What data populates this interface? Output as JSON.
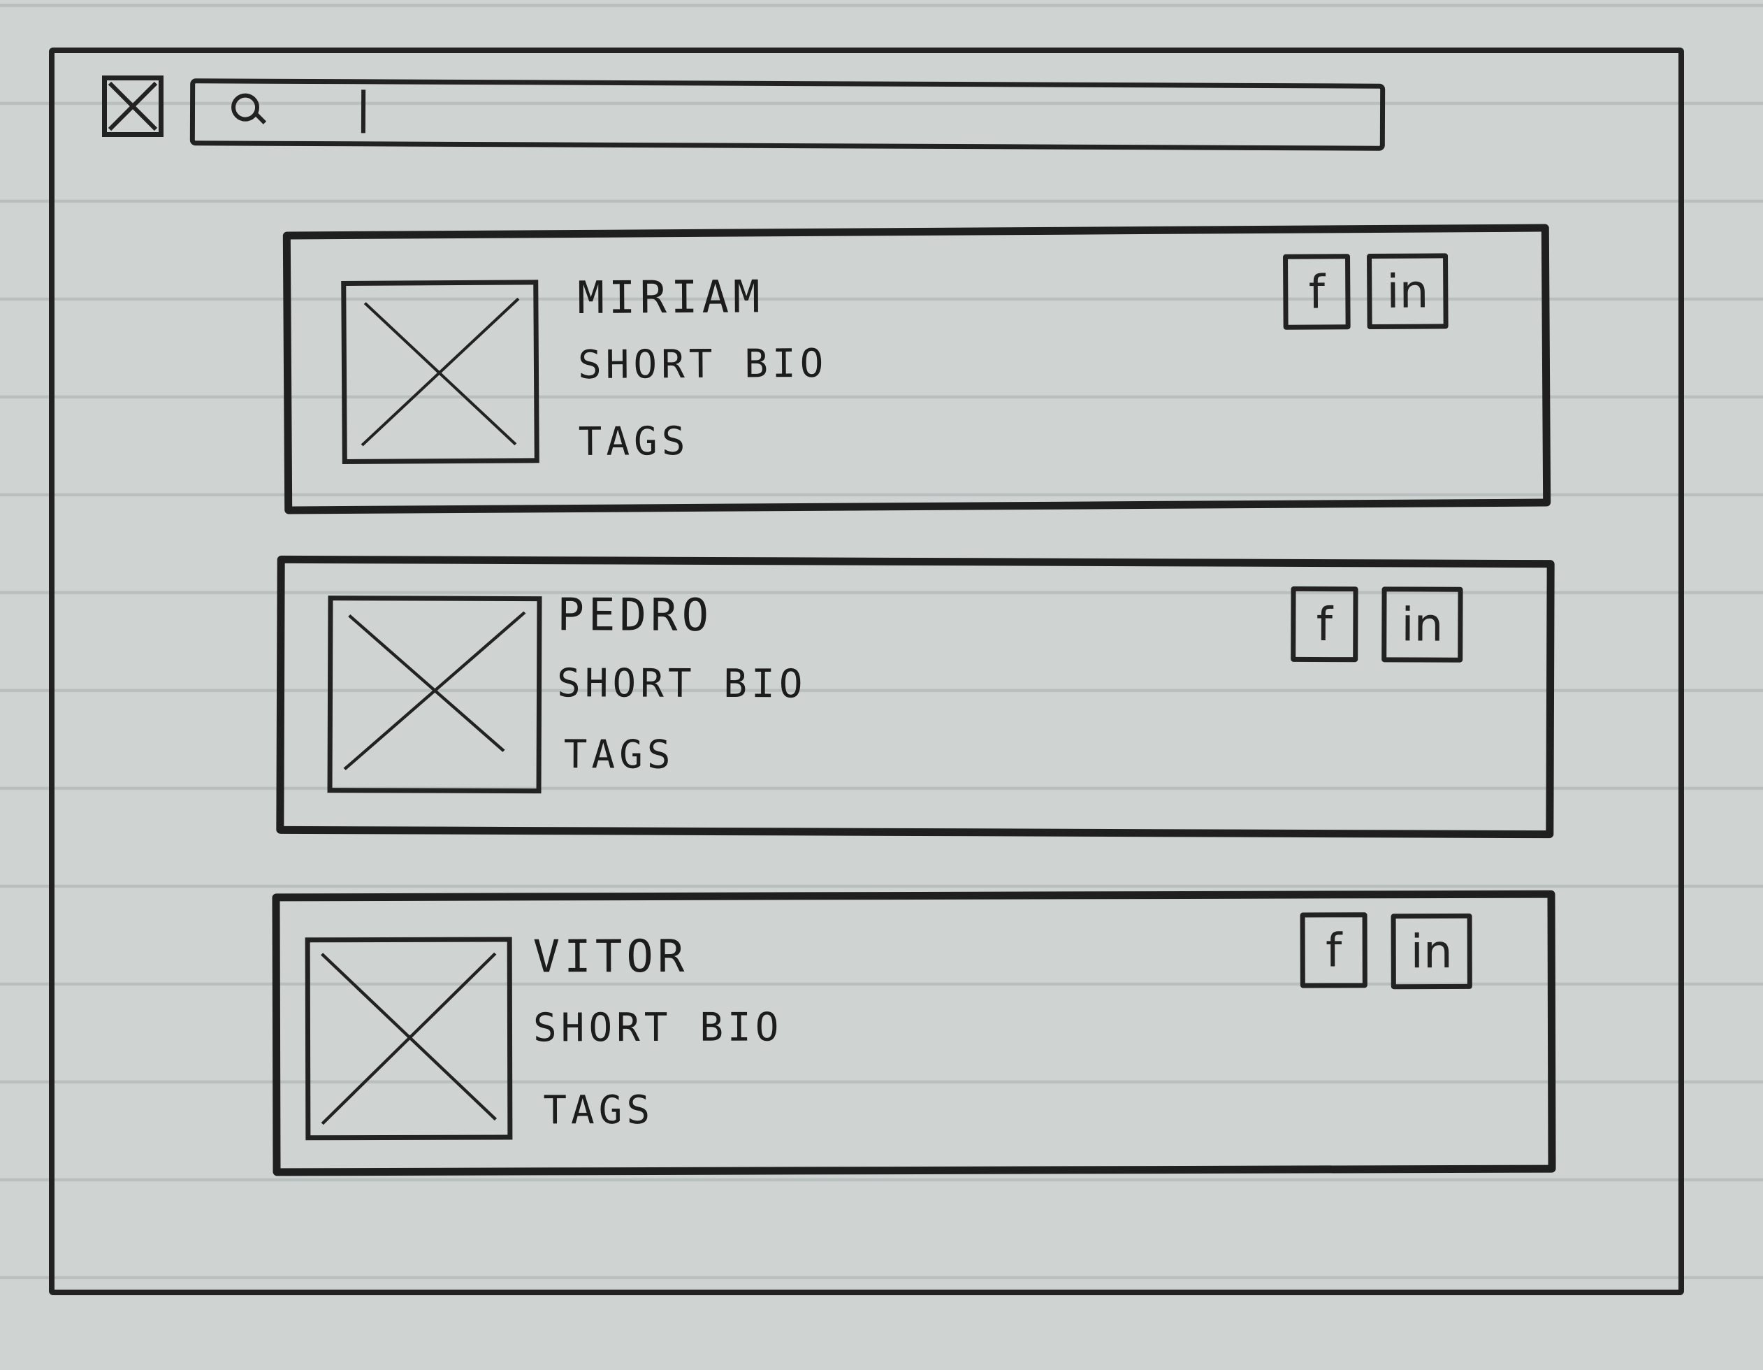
{
  "header": {
    "close_icon": "close-icon",
    "search": {
      "icon": "search-icon",
      "value": "",
      "placeholder": ""
    }
  },
  "profiles": [
    {
      "name": "MIRIAM",
      "bio": "SHORT BIO",
      "tags": "TAGS",
      "social": {
        "facebook": "f",
        "linkedin": "in"
      }
    },
    {
      "name": "PEDRO",
      "bio": "SHORT BIO",
      "tags": "TAGS",
      "social": {
        "facebook": "f",
        "linkedin": "in"
      }
    },
    {
      "name": "VITOR",
      "bio": "SHORT BIO",
      "tags": "TAGS",
      "social": {
        "facebook": "f",
        "linkedin": "in"
      }
    }
  ],
  "colors": {
    "paper": "#cfd4d3",
    "ink": "#1f1f1f",
    "ruled_line": "#b9bfbe"
  }
}
